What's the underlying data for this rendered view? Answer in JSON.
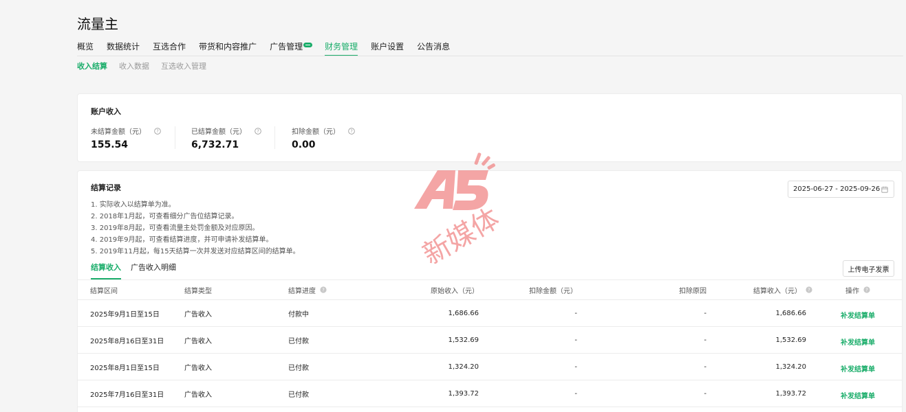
{
  "app": {
    "title": "流量主"
  },
  "nav": {
    "items": [
      {
        "label": "概览"
      },
      {
        "label": "数据统计"
      },
      {
        "label": "互选合作"
      },
      {
        "label": "带货和内容推广"
      },
      {
        "label": "广告管理"
      },
      {
        "label": "财务管理"
      },
      {
        "label": "账户设置"
      },
      {
        "label": "公告消息"
      }
    ],
    "active_index": 5
  },
  "subnav": {
    "items": [
      {
        "label": "收入结算"
      },
      {
        "label": "收入数据"
      },
      {
        "label": "互选收入管理"
      }
    ],
    "active_index": 0
  },
  "account": {
    "title": "账户收入",
    "stats": [
      {
        "label": "未结算金额（元）",
        "value": "155.54"
      },
      {
        "label": "已结算金额（元）",
        "value": "6,732.71"
      },
      {
        "label": "扣除金额（元）",
        "value": "0.00"
      }
    ]
  },
  "records": {
    "title": "结算记录",
    "notes": [
      "1. 实际收入以结算单为准。",
      "2. 2018年1月起，可查看细分广告位结算记录。",
      "3. 2019年8月起，可查看流量主处罚金额及对应原因。",
      "4. 2019年9月起，可查看结算进度，并可申请补发结算单。",
      "5. 2019年11月起，每15天结算一次并发送对应结算区间的结算单。"
    ],
    "date_range": "2025-06-27 - 2025-09-26",
    "tabs": [
      {
        "label": "结算收入"
      },
      {
        "label": "广告收入明细"
      }
    ],
    "upload_label": "上传电子发票",
    "table": {
      "headers": [
        "结算区间",
        "结算类型",
        "结算进度",
        "原始收入（元）",
        "扣除金额（元）",
        "扣除原因",
        "结算收入（元）",
        "操作"
      ],
      "rows": [
        {
          "period": "2025年9月1日至15日",
          "type": "广告收入",
          "progress": "付款中",
          "original": "1,686.66",
          "deduction": "-",
          "reason": "-",
          "settled": "1,686.66",
          "action": "补发结算单"
        },
        {
          "period": "2025年8月16日至31日",
          "type": "广告收入",
          "progress": "已付款",
          "original": "1,532.69",
          "deduction": "-",
          "reason": "-",
          "settled": "1,532.69",
          "action": "补发结算单"
        },
        {
          "period": "2025年8月1日至15日",
          "type": "广告收入",
          "progress": "已付款",
          "original": "1,324.20",
          "deduction": "-",
          "reason": "-",
          "settled": "1,324.20",
          "action": "补发结算单"
        },
        {
          "period": "2025年7月16日至31日",
          "type": "广告收入",
          "progress": "已付款",
          "original": "1,393.72",
          "deduction": "-",
          "reason": "-",
          "settled": "1,393.72",
          "action": "补发结算单"
        }
      ]
    }
  },
  "watermark": {
    "text": "A5新媒体"
  },
  "colors": {
    "accent": "#1aad6a",
    "watermark": "#f08080"
  }
}
